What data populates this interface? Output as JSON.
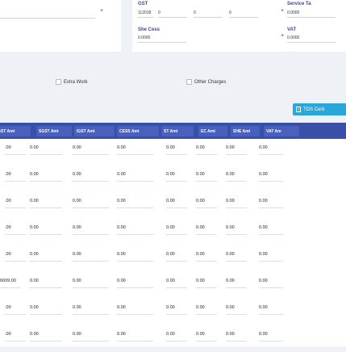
{
  "top_left": {
    "plus": "+"
  },
  "fields": {
    "gst": {
      "label": "GST",
      "values": [
        "112018",
        "0",
        "0",
        "0"
      ]
    },
    "service_tax": {
      "label": "Service Ta",
      "value": "0.0000"
    },
    "she_cess": {
      "label": "She Cess",
      "value": "0.0000"
    },
    "vat": {
      "label": "VAT",
      "value": "0.0000"
    },
    "plus": "+"
  },
  "checkboxes": {
    "extra_work": "Extra Work",
    "other_charges": "Other Charges"
  },
  "tds_button": "TDS Certi",
  "table": {
    "headers": [
      "GST Amt",
      "SGST Amt",
      "IGST Amt",
      "CESS Amt",
      "ST Amt",
      "EC Amt",
      "SHE Amt",
      "VAT Am"
    ],
    "rows": [
      [
        ".00",
        "0.00",
        "0.00",
        "0.00",
        "0.00",
        "0.00",
        "0.00",
        "0.00"
      ],
      [
        ".00",
        "0.00",
        "0.00",
        "0.00",
        "0.00",
        "0.00",
        "0.00",
        "0.00"
      ],
      [
        ".00",
        "0.00",
        "0.00",
        "0.00",
        "0.00",
        "0.00",
        "0.00",
        "0.00"
      ],
      [
        ".00",
        "0.00",
        "0.00",
        "0.00",
        "0.00",
        "0.00",
        "0.00",
        "0.00"
      ],
      [
        ".00",
        "0.00",
        "0.00",
        "0.00",
        "0.00",
        "0.00",
        "0.00",
        "0.00"
      ],
      [
        "6009.00",
        "0.00",
        "0.00",
        "0.00",
        "0.00",
        "0.00",
        "0.00",
        "0.00"
      ],
      [
        ".00",
        "0.00",
        "0.00",
        "0.00",
        "0.00",
        "0.00",
        "0.00",
        "0.00"
      ],
      [
        ".00",
        "0.00",
        "0.00",
        "0.00",
        "0.00",
        "0.00",
        "0.00",
        "0.00"
      ]
    ]
  },
  "colors": {
    "header_bg": "#3a4fa8",
    "header_cell": "#4a60bd",
    "tds_button": "#2aa7d9",
    "label": "#3c4a8c"
  }
}
